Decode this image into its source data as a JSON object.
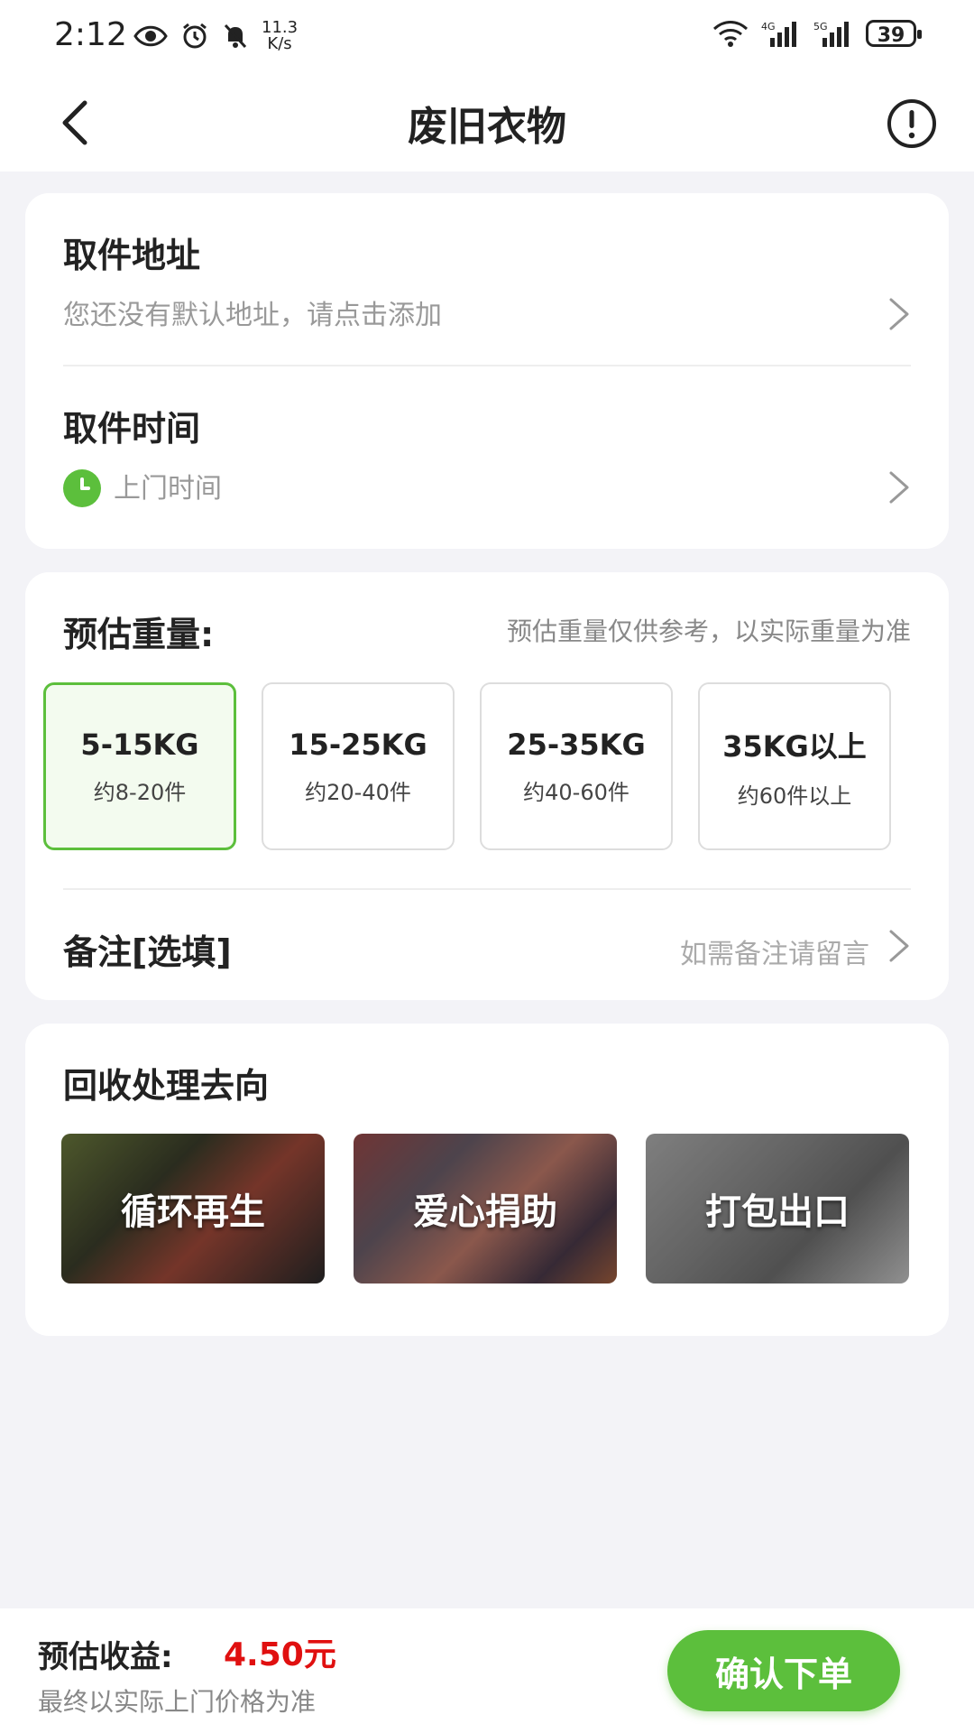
{
  "status_bar": {
    "time": "2:12",
    "speed": "11.3\nK/s",
    "battery": "39"
  },
  "header": {
    "title": "废旧衣物"
  },
  "pickup": {
    "address_title": "取件地址",
    "address_placeholder": "您还没有默认地址，请点击添加",
    "time_title": "取件时间",
    "time_placeholder": "上门时间"
  },
  "weight": {
    "title": "预估重量:",
    "note": "预估重量仅供参考，以实际重量为准",
    "options": [
      {
        "range": "5-15KG",
        "count": "约8-20件",
        "selected": true
      },
      {
        "range": "15-25KG",
        "count": "约20-40件",
        "selected": false
      },
      {
        "range": "25-35KG",
        "count": "约40-60件",
        "selected": false
      },
      {
        "range": "35KG以上",
        "count": "约60件以上",
        "selected": false
      }
    ],
    "remark_title": "备注[选填]",
    "remark_hint": "如需备注请留言"
  },
  "destination": {
    "title": "回收处理去向",
    "tiles": [
      {
        "label": "循环再生"
      },
      {
        "label": "爱心捐助"
      },
      {
        "label": "打包出口"
      }
    ]
  },
  "footer": {
    "earn_label": "预估收益:",
    "earn_value": "4.50元",
    "earn_note": "最终以实际上门价格为准",
    "confirm_label": "确认下单"
  },
  "colors": {
    "accent": "#5cbf3c",
    "price": "#e01010"
  }
}
